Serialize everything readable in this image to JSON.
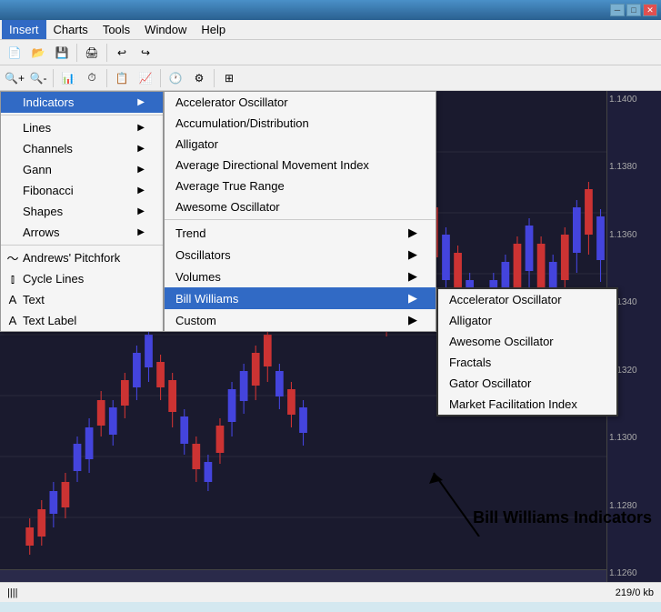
{
  "titleBar": {
    "title": "",
    "minimize": "─",
    "maximize": "□",
    "close": "✕"
  },
  "menuBar": {
    "items": [
      {
        "id": "insert",
        "label": "Insert",
        "active": true
      },
      {
        "id": "charts",
        "label": "Charts"
      },
      {
        "id": "tools",
        "label": "Tools"
      },
      {
        "id": "window",
        "label": "Window"
      },
      {
        "id": "help",
        "label": "Help"
      }
    ]
  },
  "insertMenu": {
    "items": [
      {
        "id": "indicators",
        "label": "Indicators",
        "hasArrow": true,
        "highlighted": true
      },
      {
        "separator": true
      },
      {
        "id": "lines",
        "label": "Lines",
        "hasArrow": true
      },
      {
        "id": "channels",
        "label": "Channels",
        "hasArrow": true
      },
      {
        "id": "gann",
        "label": "Gann",
        "hasArrow": true
      },
      {
        "id": "fibonacci",
        "label": "Fibonacci",
        "hasArrow": true
      },
      {
        "id": "shapes",
        "label": "Shapes",
        "hasArrow": true
      },
      {
        "id": "arrows",
        "label": "Arrows",
        "hasArrow": true
      },
      {
        "separator2": true
      },
      {
        "id": "andrews-pitchfork",
        "label": "Andrews' Pitchfork",
        "hasIcon": "~"
      },
      {
        "id": "cycle-lines",
        "label": "Cycle Lines",
        "hasIcon": "||"
      },
      {
        "id": "text",
        "label": "Text",
        "hasIcon": "A"
      },
      {
        "id": "text-label",
        "label": "Text Label",
        "hasIcon": "A"
      }
    ]
  },
  "indicatorsSubmenu": {
    "items": [
      {
        "id": "accelerator-oscillator",
        "label": "Accelerator Oscillator"
      },
      {
        "id": "accumulation-distribution",
        "label": "Accumulation/Distribution"
      },
      {
        "id": "alligator",
        "label": "Alligator"
      },
      {
        "id": "average-directional",
        "label": "Average Directional Movement Index"
      },
      {
        "id": "average-true-range",
        "label": "Average True Range"
      },
      {
        "id": "awesome-oscillator",
        "label": "Awesome Oscillator"
      },
      {
        "separator": true
      },
      {
        "id": "trend",
        "label": "Trend",
        "hasArrow": true
      },
      {
        "id": "oscillators",
        "label": "Oscillators",
        "hasArrow": true
      },
      {
        "id": "volumes",
        "label": "Volumes",
        "hasArrow": true
      },
      {
        "id": "bill-williams",
        "label": "Bill Williams",
        "hasArrow": true,
        "highlighted": true
      },
      {
        "id": "custom",
        "label": "Custom",
        "hasArrow": true
      }
    ]
  },
  "billWilliamsSubmenu": {
    "items": [
      {
        "id": "bw-accelerator",
        "label": "Accelerator Oscillator"
      },
      {
        "id": "bw-alligator",
        "label": "Alligator"
      },
      {
        "id": "bw-awesome",
        "label": "Awesome Oscillator"
      },
      {
        "id": "bw-fractals",
        "label": "Fractals"
      },
      {
        "id": "bw-gator",
        "label": "Gator Oscillator"
      },
      {
        "id": "bw-market",
        "label": "Market Facilitation Index"
      }
    ]
  },
  "annotation": {
    "label": "Bill Williams Indicators"
  },
  "statusBar": {
    "leftIcon": "||||",
    "rightText": "219/0 kb"
  },
  "priceAxis": {
    "values": [
      "1.1400",
      "1.1380",
      "1.1360",
      "1.1340",
      "1.1320",
      "1.1300",
      "1.1280",
      "1.1260"
    ]
  }
}
